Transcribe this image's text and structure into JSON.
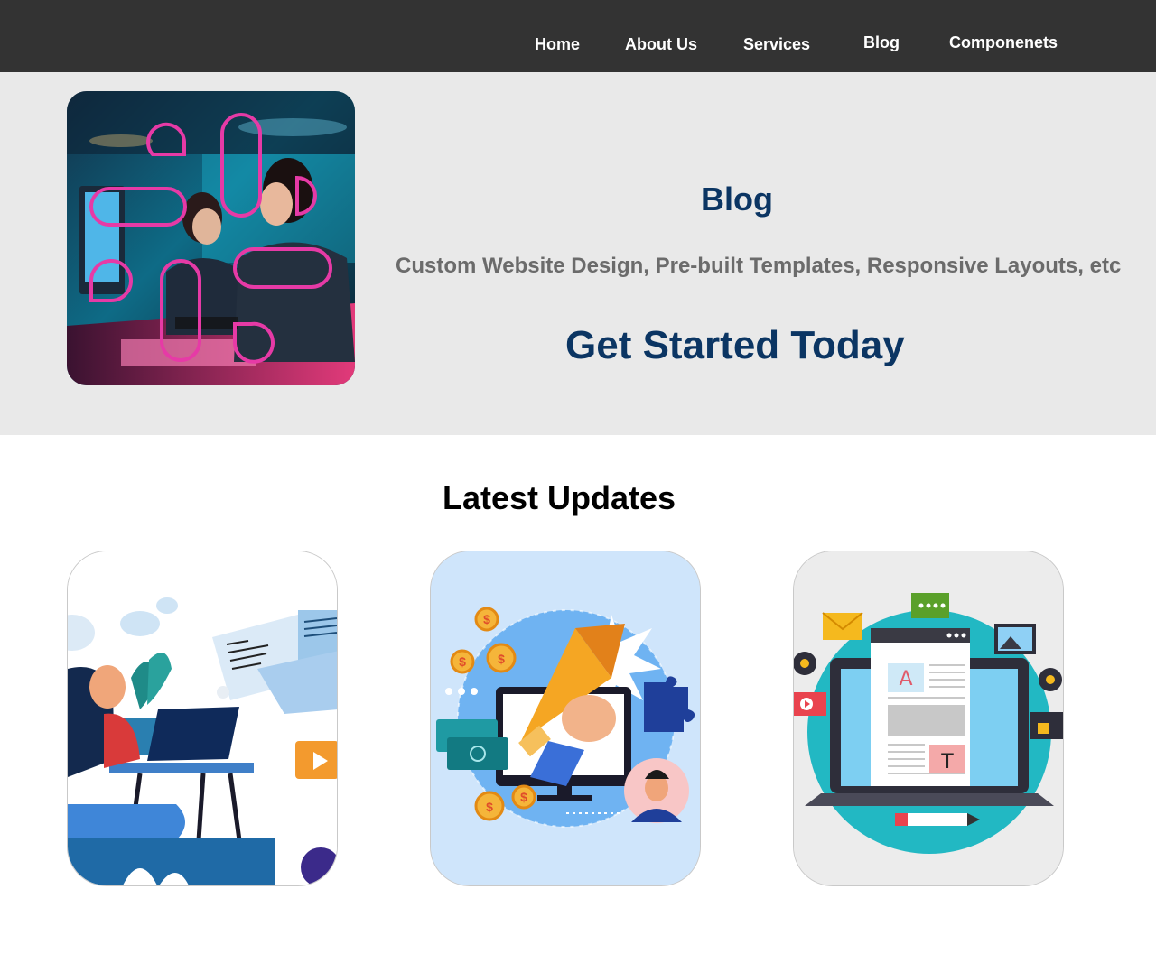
{
  "nav": {
    "items": [
      {
        "label": "Home"
      },
      {
        "label": "About Us"
      },
      {
        "label": "Services"
      },
      {
        "label": "Blog"
      },
      {
        "label": "Componenets"
      }
    ]
  },
  "hero": {
    "title": "Blog",
    "subtitle": "Custom Website Design, Pre-built Templates, Responsive Layouts, etc",
    "cta": "Get Started Today"
  },
  "updates": {
    "title": "Latest Updates",
    "cards": [
      {
        "image": "woman-at-laptop-illustration"
      },
      {
        "image": "digital-marketing-megaphone-illustration"
      },
      {
        "image": "web-content-laptop-illustration"
      }
    ]
  },
  "colors": {
    "nav_bg": "#333333",
    "hero_bg": "#e9e9e9",
    "brand_blue": "#0b3563",
    "subtitle_gray": "#6b6b6b"
  }
}
